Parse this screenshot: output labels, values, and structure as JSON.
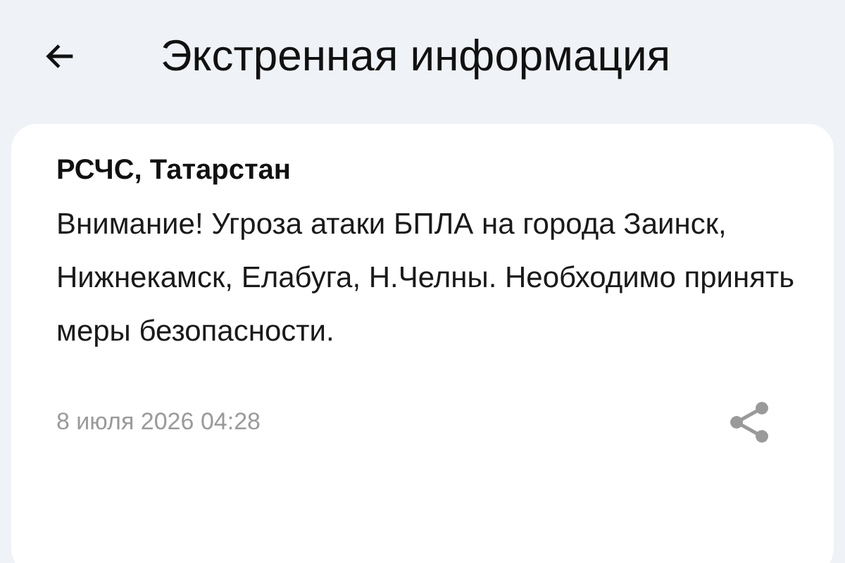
{
  "header": {
    "title": "Экстренная информация"
  },
  "message": {
    "sender": "РСЧС, Татарстан",
    "text": "Внимание! Угроза атаки БПЛА на города Заинск, Нижнекамск, Елабуга, Н.Челны. Необходимо принять меры безопасности.",
    "date": "8 июля 2026 04:28"
  }
}
